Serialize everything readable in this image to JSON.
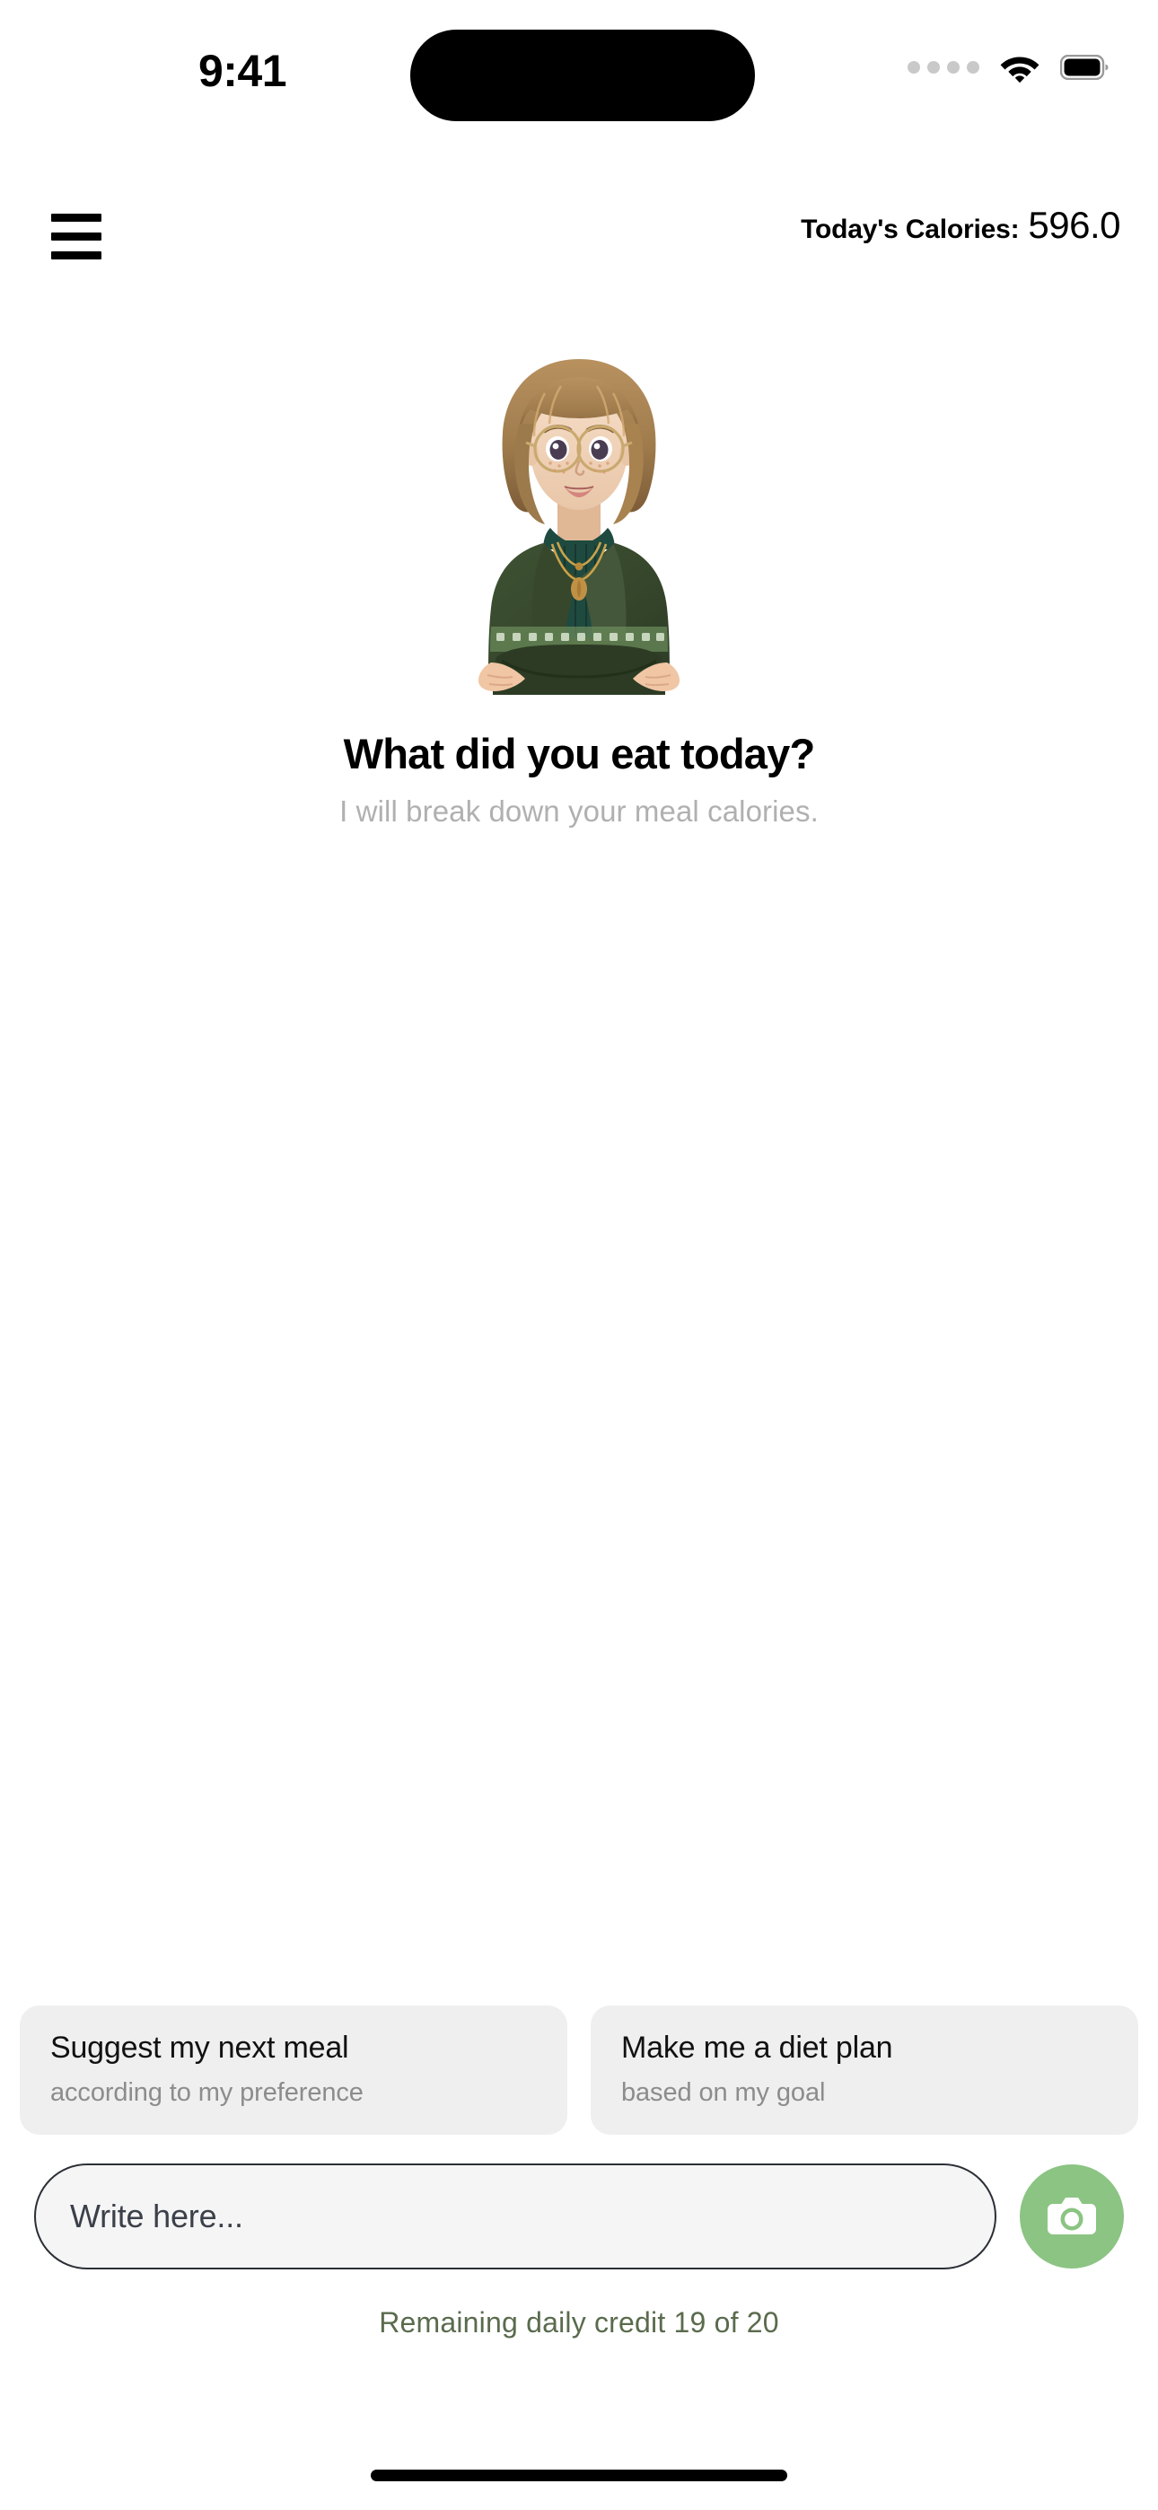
{
  "status_bar": {
    "time": "9:41",
    "cellular_icon": "cellular-dots-icon",
    "wifi_icon": "wifi-icon",
    "battery_icon": "battery-full-icon"
  },
  "header": {
    "menu_icon": "hamburger-menu-icon",
    "calorie_label": "Today's Calories:",
    "calorie_value": "596.0"
  },
  "hero": {
    "avatar_icon": "nutritionist-avatar-illustration",
    "title": "What did you eat today?",
    "subtitle": "I will break down your meal calories."
  },
  "suggestions": [
    {
      "title": "Suggest my next meal",
      "subtitle": "according to my preference"
    },
    {
      "title": "Make me a diet plan",
      "subtitle": "based on my goal"
    }
  ],
  "composer": {
    "input_placeholder": "Write here...",
    "input_value": "",
    "camera_icon": "camera-icon"
  },
  "footer": {
    "credit_text": "Remaining daily credit 19 of 20"
  },
  "colors": {
    "accent_green": "#8cc483",
    "credit_text": "#5a6b4d",
    "chip_bg": "#efefef",
    "subtitle_grey": "#b0b0b0",
    "input_bg": "#f5f5f5",
    "input_border": "#2b2f36"
  }
}
